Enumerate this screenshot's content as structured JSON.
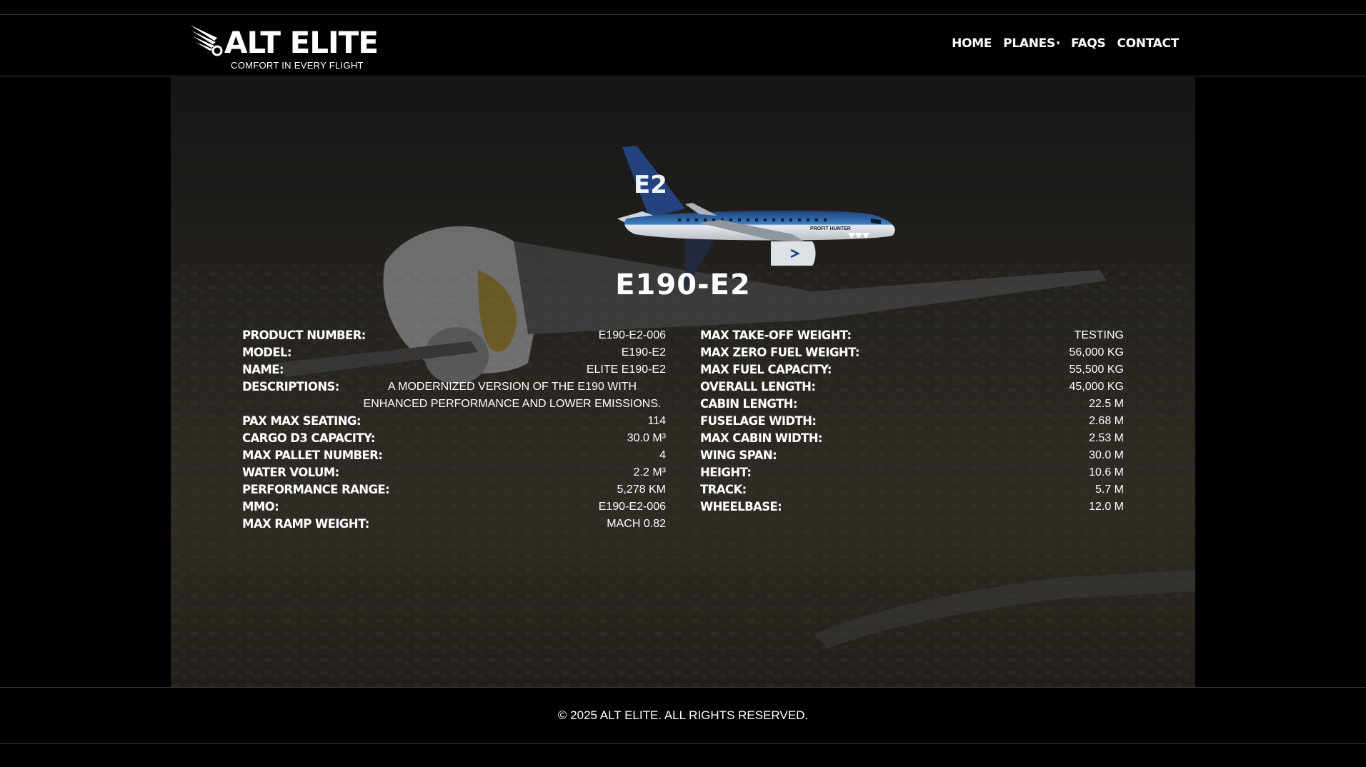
{
  "brand": {
    "name": "ALT ELITE",
    "tagline": "COMFORT IN EVERY FLIGHT"
  },
  "nav": {
    "home": "HOME",
    "planes": "PLANES",
    "faqs": "FAQS",
    "contact": "CONTACT"
  },
  "plane": {
    "tail_mark": "E2",
    "livery_text": "PROFIT HUNTER",
    "title": "E190-E2"
  },
  "specs_left": [
    {
      "label": "PRODUCT NUMBER:",
      "value": "E190-E2-006"
    },
    {
      "label": "MODEL:",
      "value": "E190-E2"
    },
    {
      "label": "NAME:",
      "value": "ELITE E190-E2"
    },
    {
      "label": "DESCRIPTIONS:",
      "value": "A MODERNIZED VERSION OF THE E190 WITH ENHANCED PERFORMANCE AND LOWER EMISSIONS."
    },
    {
      "label": "PAX MAX SEATING:",
      "value": "114"
    },
    {
      "label": "CARGO D3 CAPACITY:",
      "value": "30.0 M³"
    },
    {
      "label": "MAX PALLET NUMBER:",
      "value": "4"
    },
    {
      "label": "WATER VOLUM:",
      "value": "2.2 M³"
    },
    {
      "label": "PERFORMANCE RANGE:",
      "value": "5,278 KM"
    },
    {
      "label": "MMO:",
      "value": "E190-E2-006"
    },
    {
      "label": "MAX RAMP WEIGHT:",
      "value": "MACH 0.82"
    }
  ],
  "specs_right": [
    {
      "label": "MAX TAKE-OFF WEIGHT:",
      "value": "TESTING"
    },
    {
      "label": "MAX ZERO FUEL WEIGHT:",
      "value": "56,000 KG"
    },
    {
      "label": "MAX FUEL CAPACITY:",
      "value": "55,500 KG"
    },
    {
      "label": "OVERALL LENGTH:",
      "value": "45,000 KG"
    },
    {
      "label": "CABIN LENGTH:",
      "value": "22.5 M"
    },
    {
      "label": "FUSELAGE WIDTH:",
      "value": "2.68 M"
    },
    {
      "label": "MAX CABIN WIDTH:",
      "value": "2.53 M"
    },
    {
      "label": "WING SPAN:",
      "value": "30.0 M"
    },
    {
      "label": "HEIGHT:",
      "value": "10.6 M"
    },
    {
      "label": "TRACK:",
      "value": "5.7 M"
    },
    {
      "label": "WHEELBASE:",
      "value": "12.0 M"
    }
  ],
  "footer": {
    "copyright": "© 2025 ALT ELITE. ALL RIGHTS RESERVED."
  },
  "colors": {
    "background": "#000000",
    "text": "#ffffff",
    "fuselage": "#e9ecef",
    "livery_blue": "#1f3f7a"
  }
}
